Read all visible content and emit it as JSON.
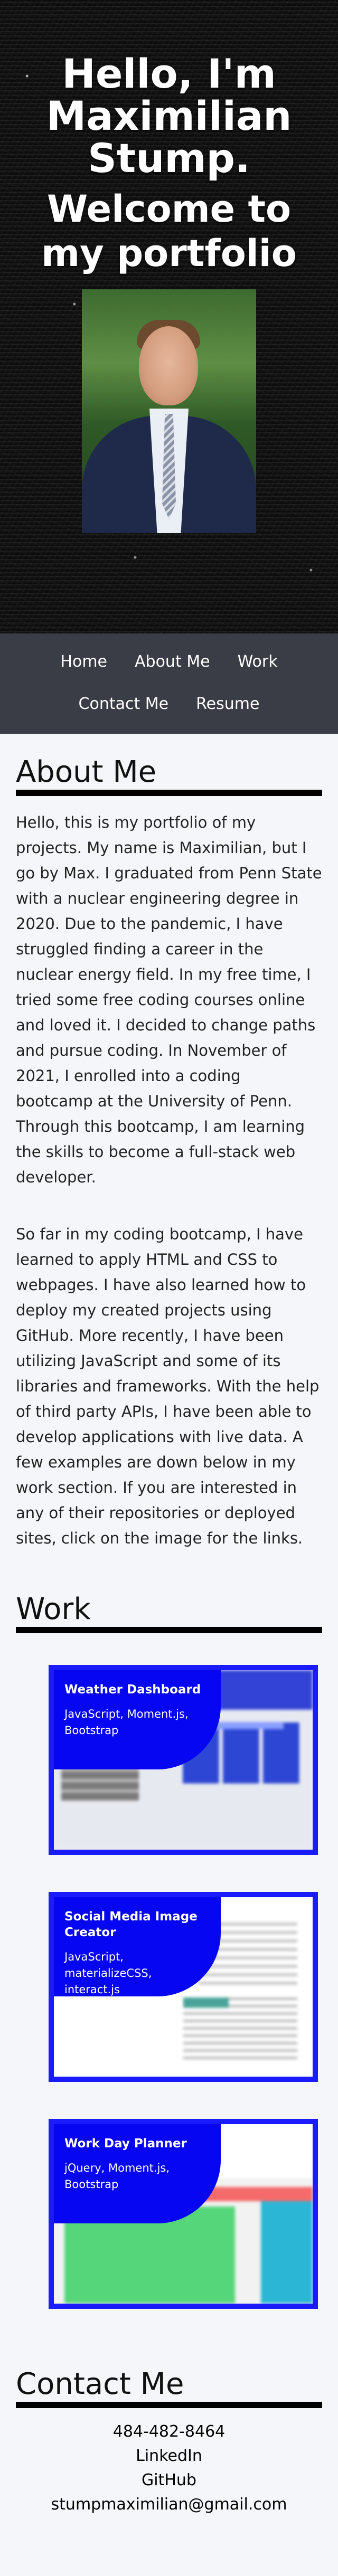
{
  "hero": {
    "greeting": "Hello, I'm Maximilian Stump.",
    "welcome": "Welcome to my portfolio"
  },
  "nav": {
    "items": [
      "Home",
      "About Me",
      "Work",
      "Contact Me",
      "Resume"
    ]
  },
  "about": {
    "title": "About Me",
    "paragraphs": [
      "Hello, this is my portfolio of my projects. My name is Maximilian, but I go by Max. I graduated from Penn State with a nuclear engineering degree in 2020. Due to the pandemic, I have struggled finding a career in the nuclear energy field. In my free time, I tried some free coding courses online and loved it. I decided to change paths and pursue coding. In November of 2021, I enrolled into a coding bootcamp at the University of Penn. Through this bootcamp, I am learning the skills to become a full-stack web developer.",
      "So far in my coding bootcamp, I have learned to apply HTML and CSS to webpages. I have also learned how to deploy my created projects using GitHub. More recently, I have been utilizing JavaScript and some of its libraries and frameworks. With the help of third party APIs, I have been able to develop applications with live data. A few examples are down below in my work section. If you are interested in any of their repositories or deployed sites, click on the image for the links."
    ]
  },
  "work": {
    "title": "Work",
    "projects": [
      {
        "title": "Weather Dashboard",
        "tech": "JavaScript, Moment.js, Bootstrap"
      },
      {
        "title": "Social Media Image Creator",
        "tech": "JavaScript, materializeCSS, interact.js"
      },
      {
        "title": "Work Day Planner",
        "tech": "jQuery, Moment.js, Bootstrap"
      }
    ]
  },
  "contact": {
    "title": "Contact Me",
    "phone": "484-482-8464",
    "linkedin": "LinkedIn",
    "github": "GitHub",
    "email": "stumpmaximilian@gmail.com"
  },
  "colors": {
    "nav_bg": "#3a3d45",
    "card_blue": "#0606f2",
    "card_border": "#1b1bff"
  },
  "icons": {}
}
